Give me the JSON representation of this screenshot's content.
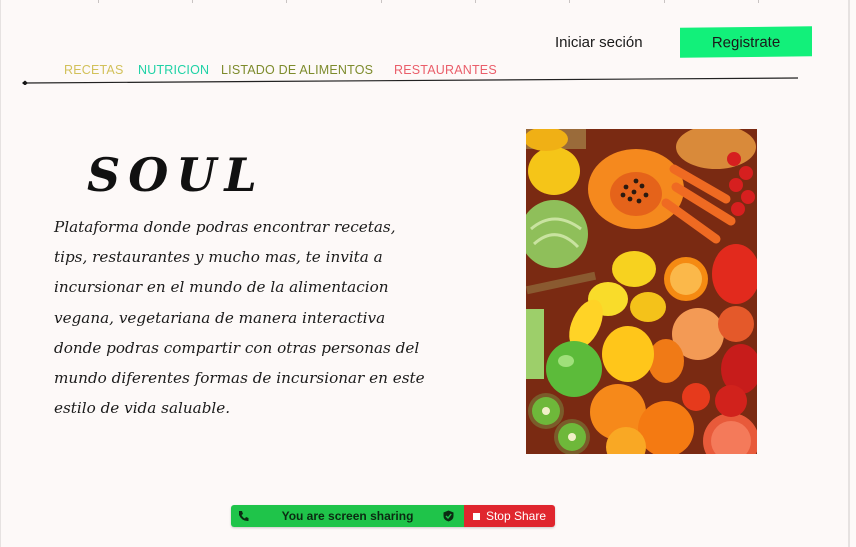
{
  "header": {
    "login_label": "Iniciar seción",
    "register_label": "Registrate"
  },
  "nav": {
    "items": [
      {
        "label": "RECETAS",
        "color": "#d2c15a"
      },
      {
        "label": "NUTRICION",
        "color": "#1fd2a6"
      },
      {
        "label": "LISTADO DE ALIMENTOS",
        "color": "#7d8b2c"
      },
      {
        "label": "RESTAURANTES",
        "color": "#ea5e6a"
      }
    ]
  },
  "hero": {
    "title": "SOUL",
    "description_lines": [
      " Plataforma donde podras encontrar recetas,",
      "tips, restaurantes y mucho mas,  te invita a",
      "incursionar en el mundo de la alimentacion",
      "vegana, vegetariana de manera interactiva",
      "donde podras  compartir con otras personas del",
      "mundo diferentes formas de incursionar en este",
      "estilo de vida saluable."
    ],
    "image_icon": "vegetables-photo"
  },
  "screen_share": {
    "status_label": "You are screen sharing",
    "stop_label": "Stop Share",
    "status_color": "#1fc44a",
    "stop_color": "#e0262e"
  },
  "colors": {
    "accent_register": "#12f07a",
    "background": "#fdf9f8"
  }
}
